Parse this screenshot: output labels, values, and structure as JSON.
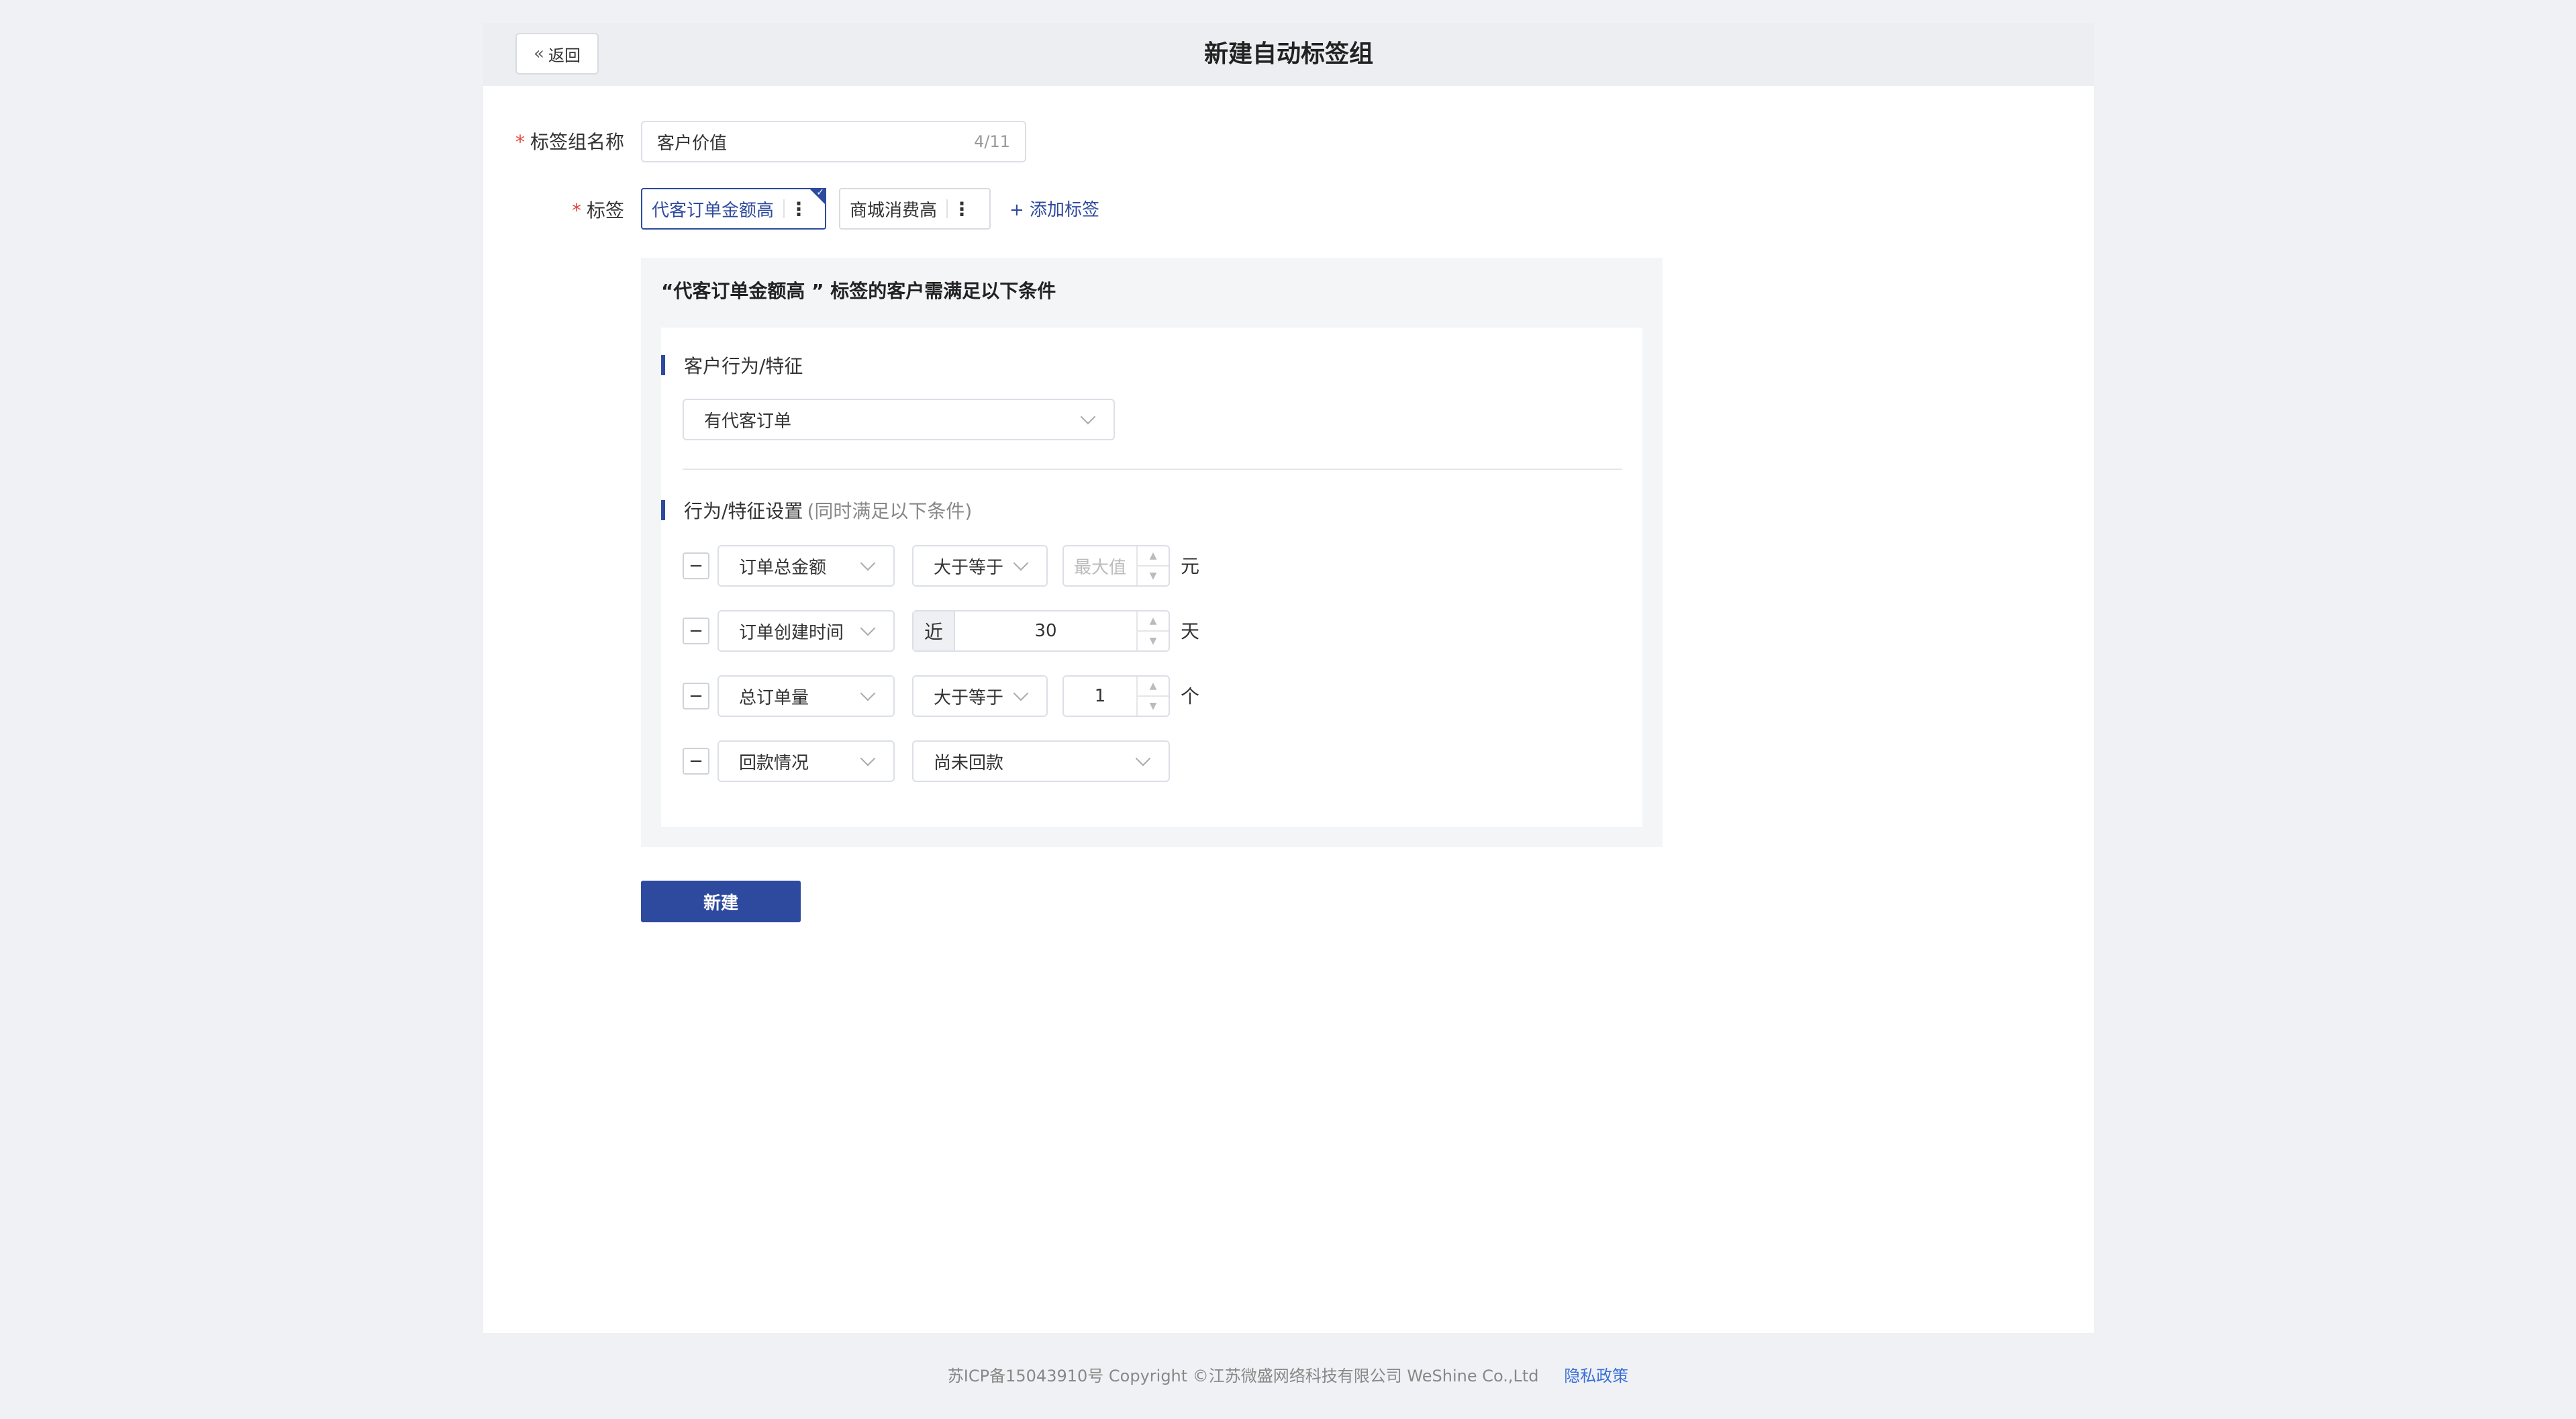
{
  "header": {
    "back_label": "返回",
    "title": "新建自动标签组"
  },
  "form": {
    "name_label": "标签组名称",
    "name_value": "客户价值",
    "name_count": "4/11",
    "tags_label": "标签",
    "required_mark": "*",
    "tags": [
      {
        "label": "代客订单金额高",
        "active": true
      },
      {
        "label": "商城消费高",
        "active": false
      }
    ],
    "add_tag": "+ 添加标签"
  },
  "conditions": {
    "title": "“代客订单金额高 ” 标签的客户需满足以下条件",
    "behavior_section": "客户行为/特征",
    "behavior_value": "有代客订单",
    "settings_section": "行为/特征设置",
    "settings_hint": "(同时满足以下条件)",
    "rows": [
      {
        "field": "订单总金额",
        "operator": "大于等于",
        "placeholder": "最大值",
        "unit": "元"
      },
      {
        "field": "订单创建时间",
        "prefix": "近",
        "value": "30",
        "unit": "天"
      },
      {
        "field": "总订单量",
        "operator": "大于等于",
        "value": "1",
        "unit": "个"
      },
      {
        "field": "回款情况",
        "status": "尚未回款"
      }
    ],
    "minus": "−"
  },
  "submit_label": "新建",
  "footer": {
    "copyright": "苏ICP备15043910号 Copyright ©江苏微盛网络科技有限公司 WeShine Co.,Ltd",
    "privacy": "隐私政策"
  }
}
